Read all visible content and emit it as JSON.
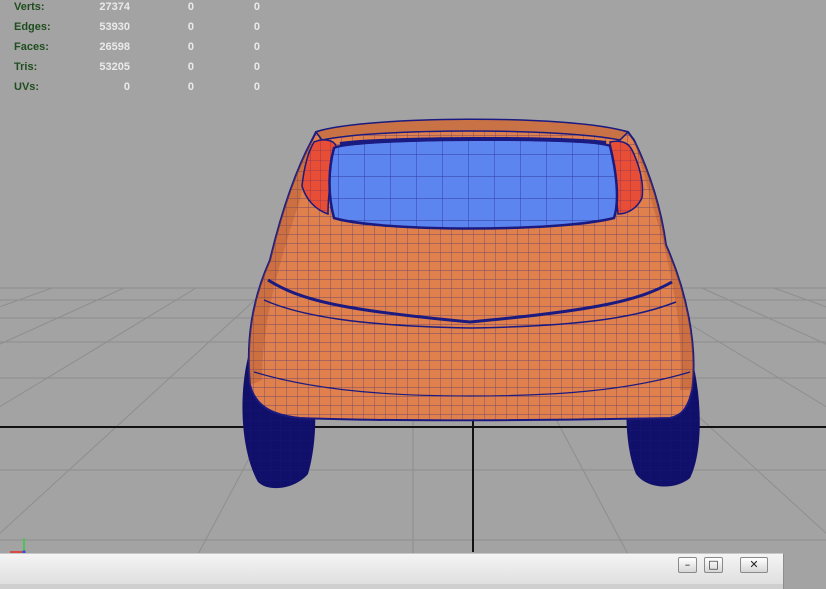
{
  "hud": {
    "rows": [
      {
        "label": "Verts:",
        "values": [
          "27374",
          "0",
          "0"
        ]
      },
      {
        "label": "Edges:",
        "values": [
          "53930",
          "0",
          "0"
        ]
      },
      {
        "label": "Faces:",
        "values": [
          "26598",
          "0",
          "0"
        ]
      },
      {
        "label": "Tris:",
        "values": [
          "53205",
          "0",
          "0"
        ]
      },
      {
        "label": "UVs:",
        "values": [
          "0",
          "0",
          "0"
        ]
      }
    ]
  },
  "window_controls": {
    "minimize": "–",
    "maximize": "□",
    "close": "✕"
  },
  "colors": {
    "viewport_bg": "#a3a3a3",
    "grid": "#8d8d8d",
    "body": "#e0814d",
    "glass": "#5d85ef",
    "lights": "#e84d35",
    "wireframe": "#1a1a80",
    "tires": "#10106a"
  },
  "icons": {
    "axis": "axis-gizmo-icon"
  }
}
